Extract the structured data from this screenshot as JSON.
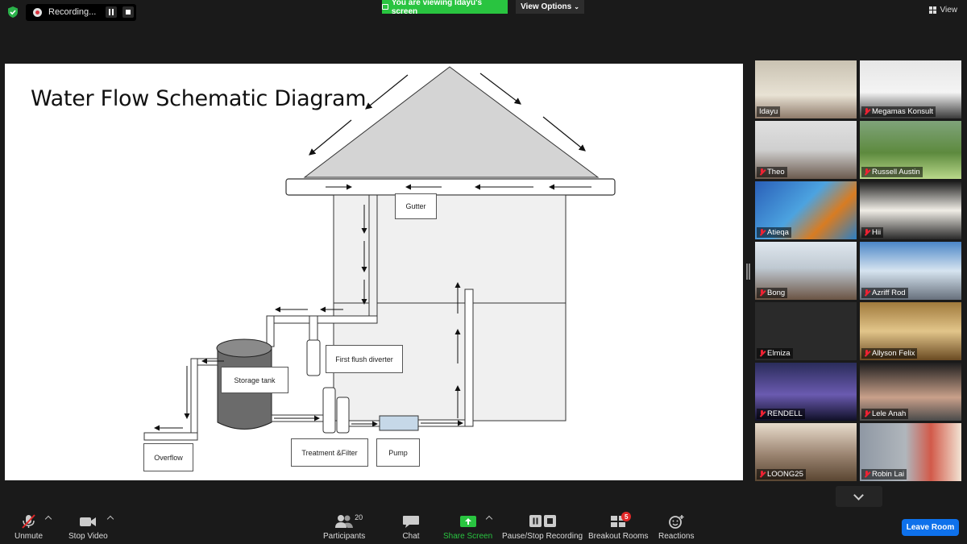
{
  "top_bar": {
    "recording_label": "Recording...",
    "viewing_banner": "You are viewing Idayu's screen",
    "view_options_label": "View Options",
    "view_label": "View"
  },
  "shared_screen": {
    "title": "Water Flow Schematic Diagram",
    "labels": {
      "gutter": "Gutter",
      "first_flush": "First flush diverter",
      "storage_tank": "Storage tank",
      "treatment": "Treatment &Filter",
      "pump": "Pump",
      "overflow": "Overflow"
    }
  },
  "participants": [
    {
      "name": "Idayu",
      "muted": false,
      "active": true
    },
    {
      "name": "Megamas Konsult",
      "muted": true
    },
    {
      "name": "Theo",
      "muted": true
    },
    {
      "name": "Russell Austin",
      "muted": true
    },
    {
      "name": "Atieqa",
      "muted": true
    },
    {
      "name": "Hii",
      "muted": true
    },
    {
      "name": "Bong",
      "muted": true
    },
    {
      "name": "Azriff Rod",
      "muted": true
    },
    {
      "name": "Elmiza",
      "muted": true
    },
    {
      "name": "Allyson Felix",
      "muted": true
    },
    {
      "name": "RENDELL",
      "muted": true
    },
    {
      "name": "Lele Anah",
      "muted": true
    },
    {
      "name": "LOONG25",
      "muted": true
    },
    {
      "name": "Robin Lai",
      "muted": true
    }
  ],
  "toolbar": {
    "unmute": "Unmute",
    "stop_video": "Stop Video",
    "participants": "Participants",
    "participants_count": "20",
    "chat": "Chat",
    "share_screen": "Share Screen",
    "pause_stop_recording": "Pause/Stop Recording",
    "breakout_rooms": "Breakout Rooms",
    "breakout_badge": "5",
    "reactions": "Reactions",
    "leave_room": "Leave Room"
  },
  "colors": {
    "accent_green": "#29c440",
    "leave_blue": "#0e71eb",
    "mute_red": "#e02828",
    "active_outline": "#cfe34a"
  }
}
